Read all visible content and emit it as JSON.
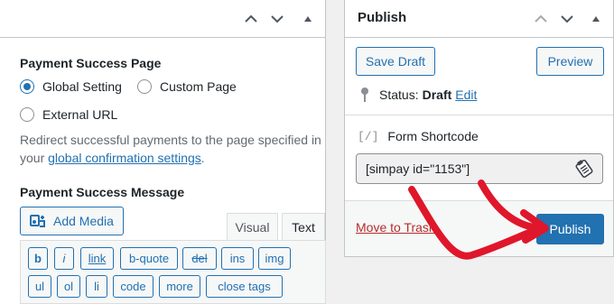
{
  "left": {
    "payment_success_page_title": "Payment Success Page",
    "radio_global": "Global Setting",
    "radio_custom": "Custom Page",
    "radio_external": "External URL",
    "help_text_before": "Redirect successful payments to the page specified in your ",
    "help_link": "global confirmation settings",
    "help_text_after": ".",
    "payment_success_message_title": "Payment Success Message",
    "add_media_label": "Add Media",
    "tab_visual": "Visual",
    "tab_text": "Text",
    "qt_buttons": {
      "b": "b",
      "i": "i",
      "link": "link",
      "bquote": "b-quote",
      "del": "del",
      "ins": "ins",
      "img": "img",
      "ul": "ul",
      "ol": "ol",
      "li": "li",
      "code": "code",
      "more": "more",
      "close_tags": "close tags"
    }
  },
  "publish": {
    "title": "Publish",
    "save_draft": "Save Draft",
    "preview": "Preview",
    "status_label": "Status:",
    "status_value": "Draft",
    "edit_link": "Edit",
    "shortcode_icon": "[/]",
    "shortcode_label": "Form Shortcode",
    "shortcode_value": "[simpay id=\"1153\"]",
    "move_to_trash": "Move to Trash",
    "publish_button": "Publish"
  },
  "colors": {
    "accent": "#2271b1",
    "danger": "#b32d2e",
    "annotation": "#e0162b"
  },
  "icons": {
    "up": "chevron-up-icon",
    "down": "chevron-down-icon",
    "toggle": "triangle-up-icon",
    "media": "add-media-icon",
    "pin": "pin-icon",
    "copy": "clipboard-icon"
  }
}
